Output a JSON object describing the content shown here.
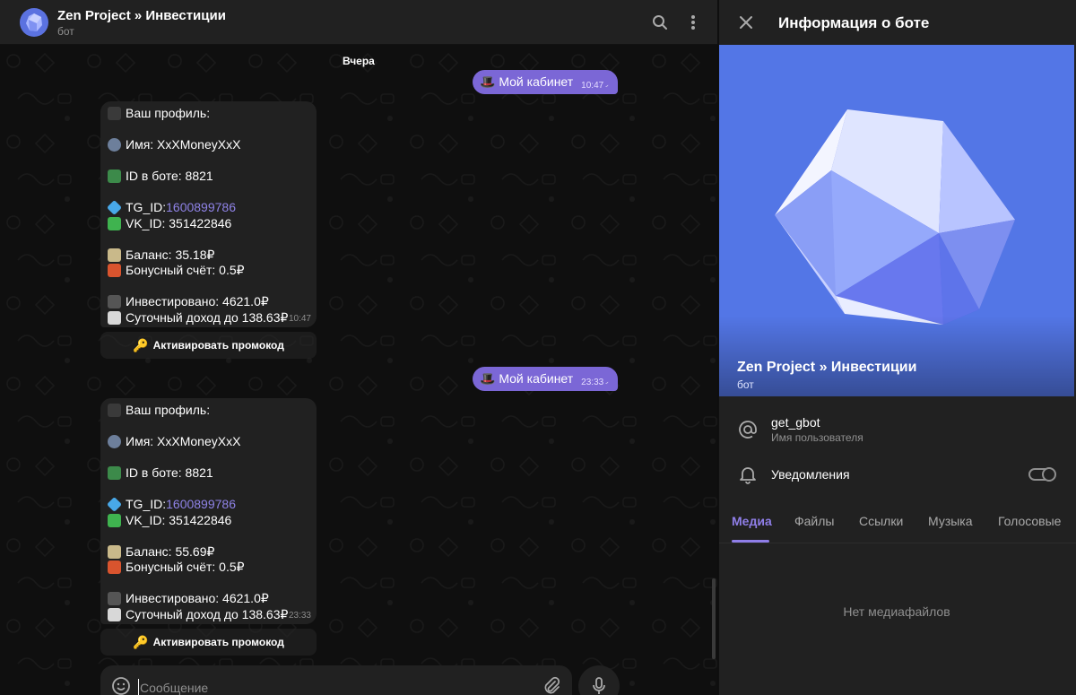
{
  "chat": {
    "title": "Zen Project » Инвестиции",
    "subtitle": "бот",
    "date_label": "Вчера",
    "composer_placeholder": "Сообщение",
    "messages_out": [
      {
        "text": "Мой кабинет",
        "time": "10:47",
        "emoji": "🎩"
      },
      {
        "text": "Мой кабинет",
        "time": "23:33",
        "emoji": "🎩"
      }
    ],
    "profiles": [
      {
        "time": "10:47",
        "header": "Ваш профиль:",
        "name": "Имя: XxXMoneyXxX",
        "bot_id": "ID в боте: 8821",
        "tg_label": "TG_ID: ",
        "tg_value": "1600899786",
        "vk": "VK_ID: 351422846",
        "balance": "Баланс: 35.18₽",
        "bonus": "Бонусный счёт: 0.5₽",
        "invested": "Инвестировано: 4621.0₽",
        "daily": "Суточный доход до 138.63₽",
        "button": "Активировать промокод"
      },
      {
        "time": "23:33",
        "header": "Ваш профиль:",
        "name": "Имя: XxXMoneyXxX",
        "bot_id": "ID в боте: 8821",
        "tg_label": "TG_ID: ",
        "tg_value": "1600899786",
        "vk": "VK_ID: 351422846",
        "balance": "Баланс: 55.69₽",
        "bonus": "Бонусный счёт: 0.5₽",
        "invested": "Инвестировано: 4621.0₽",
        "daily": "Суточный доход до 138.63₽",
        "button": "Активировать промокод"
      }
    ]
  },
  "panel": {
    "title": "Информация о боте",
    "profile_name": "Zen Project » Инвестиции",
    "profile_sub": "бот",
    "username": "get_gbot",
    "username_label": "Имя пользователя",
    "notifications_label": "Уведомления",
    "notifications_on": false,
    "tabs": [
      "Медиа",
      "Файлы",
      "Ссылки",
      "Музыка",
      "Голосовые"
    ],
    "active_tab": "Медиа",
    "empty_text": "Нет медиафайлов"
  },
  "colors": {
    "accent": "#8f7ee8",
    "outgoing_bubble": "#7b67d6",
    "incoming_bubble": "#212121",
    "profile_bg": "#5376e6"
  },
  "icons": [
    "search-icon",
    "more-vertical-icon",
    "close-icon",
    "at-icon",
    "bell-icon",
    "smile-icon",
    "paperclip-icon",
    "microphone-icon",
    "double-check-icon",
    "key-icon"
  ]
}
